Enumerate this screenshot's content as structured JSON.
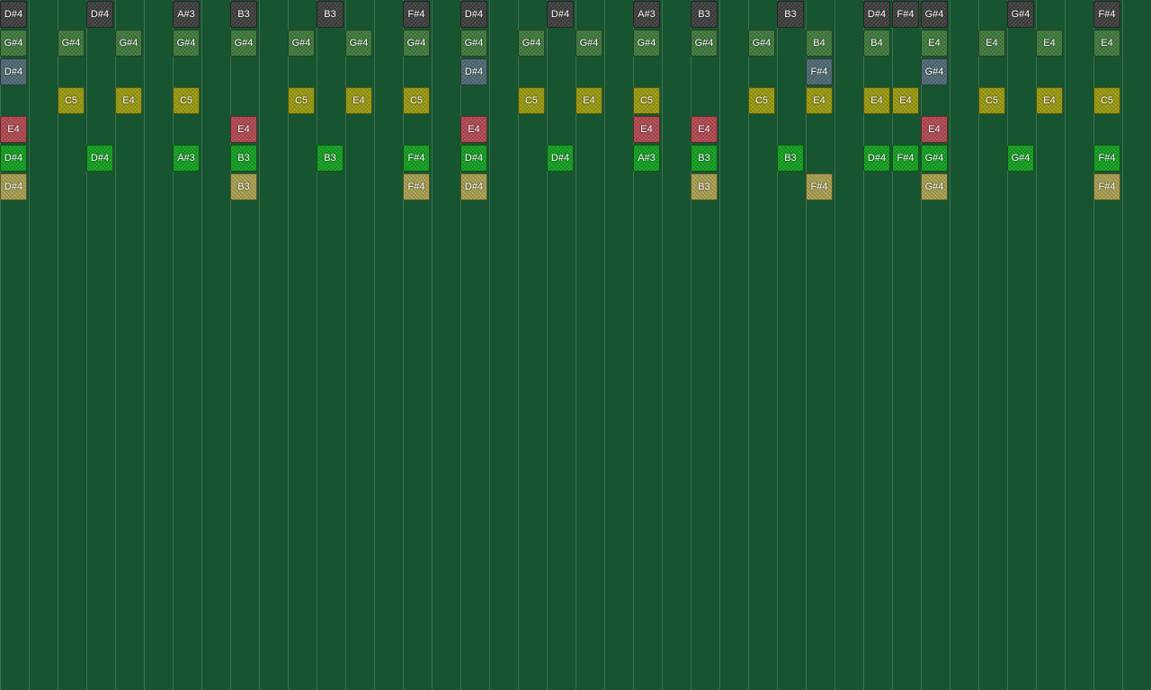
{
  "track_colors": [
    "#3e3e3e",
    "#3f7a3c",
    "#4e6a72",
    "#9a9a10",
    "#b24850",
    "#12a020",
    "#a9a050"
  ],
  "tracks": [
    {
      "notes": [
        {
          "step": 0,
          "label": "D#4"
        },
        {
          "step": 3,
          "label": "D#4"
        },
        {
          "step": 6,
          "label": "A#3"
        },
        {
          "step": 8,
          "label": "B3"
        },
        {
          "step": 11,
          "label": "B3"
        },
        {
          "step": 14,
          "label": "F#4"
        },
        {
          "step": 16,
          "label": "D#4"
        },
        {
          "step": 19,
          "label": "D#4"
        },
        {
          "step": 22,
          "label": "A#3"
        },
        {
          "step": 24,
          "label": "B3"
        },
        {
          "step": 27,
          "label": "B3"
        },
        {
          "step": 30,
          "label": "D#4"
        },
        {
          "step": 31,
          "label": "F#4"
        },
        {
          "step": 32,
          "label": "G#4"
        },
        {
          "step": 35,
          "label": "G#4"
        },
        {
          "step": 38,
          "label": "F#4"
        }
      ]
    },
    {
      "notes": [
        {
          "step": 0,
          "label": "G#4"
        },
        {
          "step": 2,
          "label": "G#4"
        },
        {
          "step": 4,
          "label": "G#4"
        },
        {
          "step": 6,
          "label": "G#4"
        },
        {
          "step": 8,
          "label": "G#4"
        },
        {
          "step": 10,
          "label": "G#4"
        },
        {
          "step": 12,
          "label": "G#4"
        },
        {
          "step": 14,
          "label": "G#4"
        },
        {
          "step": 16,
          "label": "G#4"
        },
        {
          "step": 18,
          "label": "G#4"
        },
        {
          "step": 20,
          "label": "G#4"
        },
        {
          "step": 22,
          "label": "G#4"
        },
        {
          "step": 24,
          "label": "G#4"
        },
        {
          "step": 26,
          "label": "G#4"
        },
        {
          "step": 28,
          "label": "B4"
        },
        {
          "step": 30,
          "label": "B4"
        },
        {
          "step": 32,
          "label": "E4"
        },
        {
          "step": 34,
          "label": "E4"
        },
        {
          "step": 36,
          "label": "E4"
        },
        {
          "step": 38,
          "label": "E4"
        }
      ]
    },
    {
      "notes": [
        {
          "step": 0,
          "label": "D#4"
        },
        {
          "step": 16,
          "label": "D#4"
        },
        {
          "step": 28,
          "label": "F#4"
        },
        {
          "step": 32,
          "label": "G#4"
        }
      ]
    },
    {
      "notes": [
        {
          "step": 2,
          "label": "C5"
        },
        {
          "step": 4,
          "label": "E4"
        },
        {
          "step": 6,
          "label": "C5"
        },
        {
          "step": 10,
          "label": "C5"
        },
        {
          "step": 12,
          "label": "E4"
        },
        {
          "step": 14,
          "label": "C5"
        },
        {
          "step": 18,
          "label": "C5"
        },
        {
          "step": 20,
          "label": "E4"
        },
        {
          "step": 22,
          "label": "C5"
        },
        {
          "step": 26,
          "label": "C5"
        },
        {
          "step": 28,
          "label": "E4"
        },
        {
          "step": 30,
          "label": "E4"
        },
        {
          "step": 31,
          "label": "E4"
        },
        {
          "step": 34,
          "label": "C5"
        },
        {
          "step": 36,
          "label": "E4"
        },
        {
          "step": 38,
          "label": "C5"
        }
      ]
    },
    {
      "notes": [
        {
          "step": 0,
          "label": "E4"
        },
        {
          "step": 8,
          "label": "E4"
        },
        {
          "step": 16,
          "label": "E4"
        },
        {
          "step": 22,
          "label": "E4"
        },
        {
          "step": 24,
          "label": "E4"
        },
        {
          "step": 32,
          "label": "E4"
        }
      ]
    },
    {
      "notes": [
        {
          "step": 0,
          "label": "D#4"
        },
        {
          "step": 3,
          "label": "D#4"
        },
        {
          "step": 6,
          "label": "A#3"
        },
        {
          "step": 8,
          "label": "B3"
        },
        {
          "step": 11,
          "label": "B3"
        },
        {
          "step": 14,
          "label": "F#4"
        },
        {
          "step": 16,
          "label": "D#4"
        },
        {
          "step": 19,
          "label": "D#4"
        },
        {
          "step": 22,
          "label": "A#3"
        },
        {
          "step": 24,
          "label": "B3"
        },
        {
          "step": 27,
          "label": "B3"
        },
        {
          "step": 30,
          "label": "D#4"
        },
        {
          "step": 31,
          "label": "F#4"
        },
        {
          "step": 32,
          "label": "G#4"
        },
        {
          "step": 35,
          "label": "G#4"
        },
        {
          "step": 38,
          "label": "F#4"
        }
      ]
    },
    {
      "notes": [
        {
          "step": 0,
          "label": "D#4"
        },
        {
          "step": 8,
          "label": "B3"
        },
        {
          "step": 14,
          "label": "F#4"
        },
        {
          "step": 16,
          "label": "D#4"
        },
        {
          "step": 24,
          "label": "B3"
        },
        {
          "step": 28,
          "label": "F#4"
        },
        {
          "step": 32,
          "label": "G#4"
        },
        {
          "step": 38,
          "label": "F#4"
        }
      ]
    }
  ]
}
